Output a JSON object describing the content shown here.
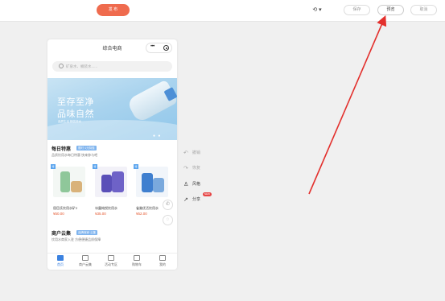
{
  "toolbar": {
    "publish_label": "发 布",
    "device_label": "⟲ ▾",
    "save_label": "保存",
    "preview_label": "预览",
    "cancel_label": "取消"
  },
  "phone": {
    "title": "综合电商",
    "capsule_more": "•••",
    "search_placeholder": "矿泉水、桶装水......",
    "banner": {
      "line1": "至存至净",
      "line2": "品味自然",
      "line3": "品质生活 畅饮好水",
      "indicator": "● ●"
    },
    "daily": {
      "title": "每日特惠",
      "tag": "限时·1元特惠",
      "subtitle": "品质饮用水每日特惠 快来参与吧"
    },
    "products": [
      {
        "badge": "特",
        "name": "屈臣氏饮用水矿2",
        "price": "¥50.00"
      },
      {
        "badge": "特",
        "name": "冰露纯悦饮用水",
        "price": "¥35.00"
      },
      {
        "badge": "特",
        "name": "雀巢优活饮用水",
        "price": "¥52.00"
      }
    ],
    "merchant": {
      "title": "商户云集",
      "tag": "品牌商家·云集",
      "subtitle": "饮用水商家入驻 方便便捷品质保障"
    },
    "nav": [
      {
        "label": "首页"
      },
      {
        "label": "商户云集"
      },
      {
        "label": "活动专区"
      },
      {
        "label": "购物车"
      },
      {
        "label": "我的"
      }
    ]
  },
  "side_actions": {
    "undo": "撤销",
    "redo": "恢复",
    "style": "风格",
    "share": "分享",
    "share_badge": "NEW"
  },
  "colors": {
    "accent_orange": "#ef6b4e",
    "brand_blue": "#3b82e0",
    "annotation_red": "#e3302d"
  }
}
